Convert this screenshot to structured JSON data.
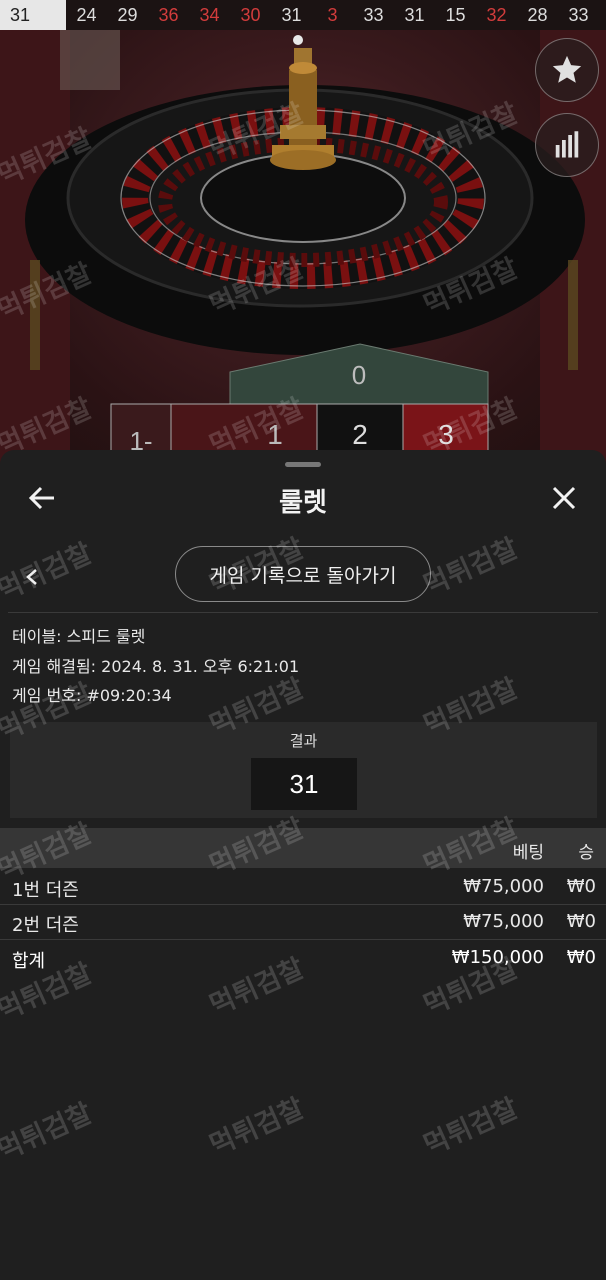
{
  "results_strip": [
    {
      "value": "31",
      "color": "black"
    },
    {
      "value": "24",
      "color": "black"
    },
    {
      "value": "29",
      "color": "black"
    },
    {
      "value": "36",
      "color": "red"
    },
    {
      "value": "34",
      "color": "red"
    },
    {
      "value": "30",
      "color": "red"
    },
    {
      "value": "31",
      "color": "black"
    },
    {
      "value": "3",
      "color": "red"
    },
    {
      "value": "33",
      "color": "black"
    },
    {
      "value": "31",
      "color": "black"
    },
    {
      "value": "15",
      "color": "black"
    },
    {
      "value": "32",
      "color": "red"
    },
    {
      "value": "28",
      "color": "black"
    },
    {
      "value": "33",
      "color": "black"
    }
  ],
  "scene": {
    "board_numbers": {
      "zero": "0",
      "n1": "1",
      "n2": "2",
      "n3": "3",
      "partial": "1-"
    }
  },
  "side_buttons": {
    "favorite_icon": "star-icon",
    "stats_icon": "bar-chart-icon"
  },
  "sheet": {
    "title": "룰렛",
    "back_icon": "arrow-left-icon",
    "close_icon": "close-icon",
    "history_button": "게임 기록으로 돌아가기",
    "info": {
      "table": "테이블: 스피드 룰렛",
      "resolved": "게임 해결됨: 2024. 8. 31. 오후 6:21:01",
      "game_number": "게임 번호: #09:20:34"
    },
    "result": {
      "label": "결과",
      "value": "31"
    },
    "table": {
      "headers": {
        "bet": "베팅",
        "win": "승"
      },
      "rows": [
        {
          "name": "1번 더즌",
          "bet": "₩75,000",
          "win": "₩0"
        },
        {
          "name": "2번 더즌",
          "bet": "₩75,000",
          "win": "₩0"
        }
      ],
      "total": {
        "name": "합계",
        "bet": "₩150,000",
        "win": "₩0"
      }
    }
  },
  "watermark": "먹튀검찰",
  "colors": {
    "red": "#d23c3c",
    "sheet_bg": "#1f1f1f",
    "header_row": "#363636"
  }
}
